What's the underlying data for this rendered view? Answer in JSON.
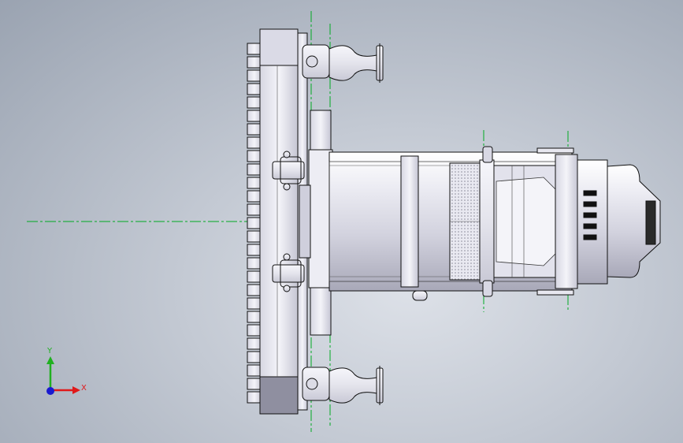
{
  "triad": {
    "x_label": "X",
    "y_label": "Y",
    "x_color": "#e0191a",
    "y_color": "#20b020",
    "z_color": "#1a1ad0"
  },
  "colors": {
    "background_center": "#dde1e8",
    "background_edge": "#9aa3b1",
    "part_fill": "#e6e6ee",
    "part_highlight": "#f7f7fb",
    "part_shadow": "#b8b8c8",
    "part_stroke": "#101010",
    "dark_face": "#9a9aaa",
    "centerline": "#00aa22"
  },
  "icons": {
    "orientation": "axis-triad-icon"
  }
}
